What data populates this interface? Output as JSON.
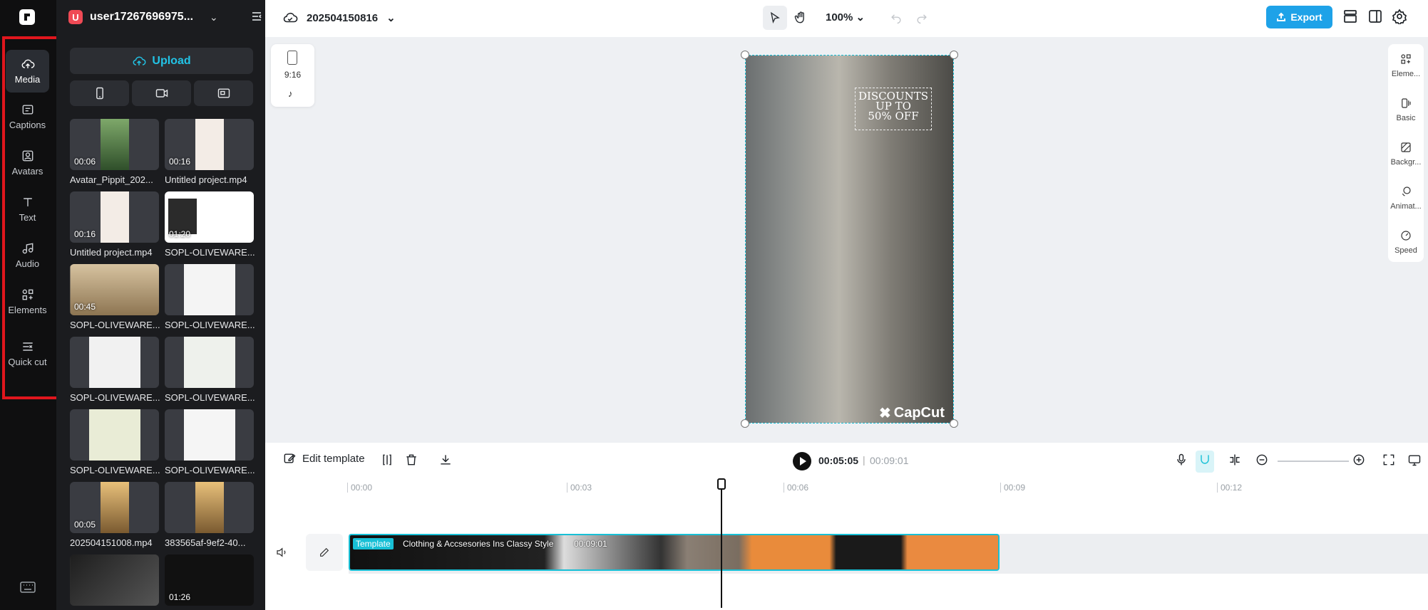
{
  "rail": {
    "items": [
      {
        "label": "Media",
        "icon": "cloud-upload-icon"
      },
      {
        "label": "Captions",
        "icon": "captions-icon"
      },
      {
        "label": "Avatars",
        "icon": "avatar-icon"
      },
      {
        "label": "Text",
        "icon": "text-icon"
      },
      {
        "label": "Audio",
        "icon": "audio-icon"
      },
      {
        "label": "Elements",
        "icon": "elements-icon"
      },
      {
        "label": "Quick cut",
        "icon": "quick-cut-icon"
      }
    ],
    "highlight_color": "#e0161d"
  },
  "panel": {
    "avatar_letter": "U",
    "username": "user17267696975...",
    "upload_label": "Upload",
    "media": [
      {
        "name": "Avatar_Pippit_202...",
        "duration": "00:06"
      },
      {
        "name": "Untitled project.mp4",
        "duration": "00:16"
      },
      {
        "name": "Untitled project.mp4",
        "duration": "00:16"
      },
      {
        "name": "SOPL-OLIVEWARE...",
        "duration": "01:20"
      },
      {
        "name": "SOPL-OLIVEWARE...",
        "duration": "00:45"
      },
      {
        "name": "SOPL-OLIVEWARE...",
        "duration": ""
      },
      {
        "name": "SOPL-OLIVEWARE...",
        "duration": ""
      },
      {
        "name": "SOPL-OLIVEWARE...",
        "duration": ""
      },
      {
        "name": "SOPL-OLIVEWARE...",
        "duration": ""
      },
      {
        "name": "SOPL-OLIVEWARE...",
        "duration": ""
      },
      {
        "name": "202504151008.mp4",
        "duration": "00:05"
      },
      {
        "name": "383565af-9ef2-40...",
        "duration": ""
      },
      {
        "name": "",
        "duration": ""
      },
      {
        "name": "",
        "duration": "01:26"
      }
    ]
  },
  "topbar": {
    "project_name": "202504150816",
    "zoom": "100%",
    "export_label": "Export",
    "accent": "#1ea2e8"
  },
  "canvas": {
    "ratio_label": "9:16",
    "promo_line1": "DISCOUNTS",
    "promo_line2": "UP TO",
    "promo_line3": "50% OFF",
    "brand": "CapCut",
    "right_tools": [
      "Eleme...",
      "Basic",
      "Backgr...",
      "Animat...",
      "Speed"
    ]
  },
  "timeline": {
    "edit_template_label": "Edit template",
    "current_time": "00:05:05",
    "separator": "|",
    "total_time": "00:09:01",
    "ruler": [
      "00:00",
      "00:03",
      "00:06",
      "00:09",
      "00:12"
    ],
    "clip_tag": "Template",
    "clip_title": "Clothing & Accsesories Ins Classy Style",
    "clip_duration": "00:09:01",
    "clip_color": "#18c0d6"
  }
}
